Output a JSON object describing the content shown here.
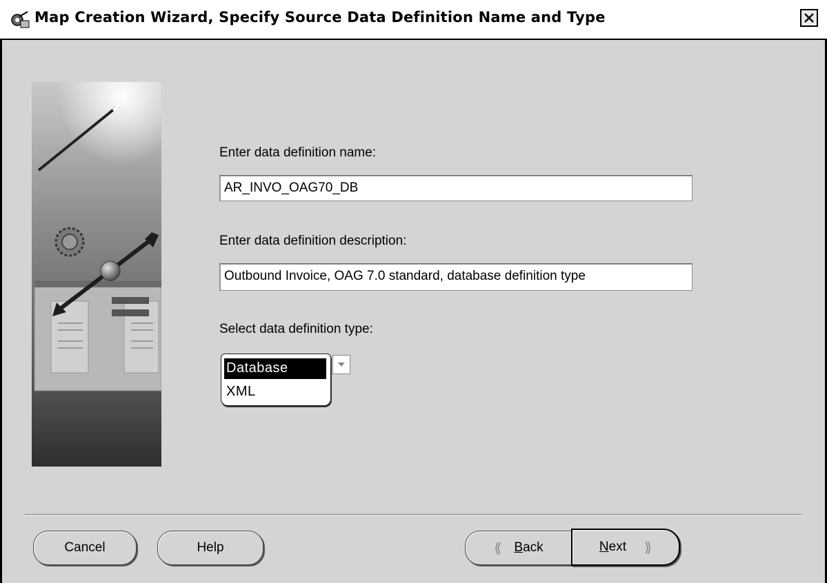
{
  "window": {
    "title": "Map Creation Wizard, Specify Source Data Definition Name and Type"
  },
  "form": {
    "name_label": "Enter data definition name:",
    "name_value": "AR_INVO_OAG70_DB",
    "description_label": "Enter data definition description:",
    "description_value": "Outbound Invoice, OAG 7.0 standard, database definition type",
    "type_label": "Select data definition type:",
    "type_options": [
      "Database",
      "XML"
    ],
    "type_selected": "Database"
  },
  "buttons": {
    "cancel": "Cancel",
    "help": "Help",
    "back_prefix": "B",
    "back_rest": "ack",
    "next_prefix": "N",
    "next_rest": "ext"
  },
  "icons": {
    "app": "wizard-app-icon",
    "close": "close-icon",
    "dropdown": "chevron-down-icon",
    "back": "double-chevron-left-icon",
    "next": "double-chevron-right-icon"
  }
}
